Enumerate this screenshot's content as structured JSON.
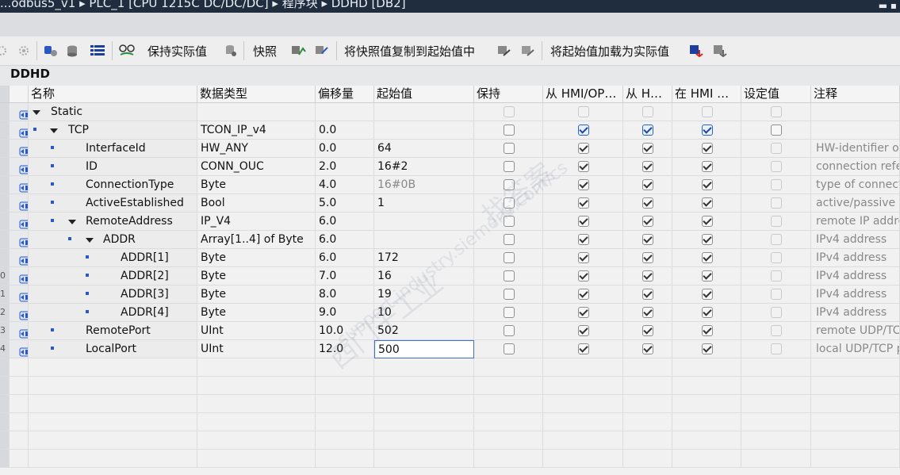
{
  "window": {
    "title": "...odbus5_v1 ▸ PLC_1 [CPU 1215C DC/DC/DC] ▸ 程序块 ▸ DDHD [DB2]"
  },
  "toolbar": {
    "keep_actual_label": "保持实际值",
    "snapshot_label": "快照",
    "copy_snapshot_label": "将快照值复制到起始值中",
    "load_start_label": "将起始值加载为实际值"
  },
  "block": {
    "name": "DDHD"
  },
  "columns": {
    "name": "名称",
    "datatype": "数据类型",
    "offset": "偏移量",
    "start": "起始值",
    "retain": "保持",
    "hmi_access": "从 HMI/OP…",
    "hmi_write": "从 H…",
    "hmi_visible": "在 HMI …",
    "setpoint": "设定值",
    "comment": "注释"
  },
  "rows": [
    {
      "num": "",
      "name": "Static",
      "type": "",
      "offset": "",
      "start": "",
      "comment": ""
    },
    {
      "num": "",
      "name": "TCP",
      "type": "TCON_IP_v4",
      "offset": "0.0",
      "start": "",
      "comment": ""
    },
    {
      "num": "",
      "name": "InterfaceId",
      "type": "HW_ANY",
      "offset": "0.0",
      "start": "64",
      "comment": "HW-identifier of I"
    },
    {
      "num": "",
      "name": "ID",
      "type": "CONN_OUC",
      "offset": "2.0",
      "start": "16#2",
      "comment": "connection refere"
    },
    {
      "num": "",
      "name": "ConnectionType",
      "type": "Byte",
      "offset": "4.0",
      "start": "16#0B",
      "comment": "type of connectio"
    },
    {
      "num": "",
      "name": "ActiveEstablished",
      "type": "Bool",
      "offset": "5.0",
      "start": "1",
      "comment": "active/passive co"
    },
    {
      "num": "",
      "name": "RemoteAddress",
      "type": "IP_V4",
      "offset": "6.0",
      "start": "",
      "comment": "remote IP addres"
    },
    {
      "num": "",
      "name": "ADDR",
      "type": "Array[1..4] of Byte",
      "offset": "6.0",
      "start": "",
      "comment": "IPv4 address"
    },
    {
      "num": "",
      "name": "ADDR[1]",
      "type": "Byte",
      "offset": "6.0",
      "start": "172",
      "comment": "IPv4 address"
    },
    {
      "num": "0",
      "name": "ADDR[2]",
      "type": "Byte",
      "offset": "7.0",
      "start": "16",
      "comment": "IPv4 address"
    },
    {
      "num": "1",
      "name": "ADDR[3]",
      "type": "Byte",
      "offset": "8.0",
      "start": "19",
      "comment": "IPv4 address"
    },
    {
      "num": "2",
      "name": "ADDR[4]",
      "type": "Byte",
      "offset": "9.0",
      "start": "10",
      "comment": "IPv4 address"
    },
    {
      "num": "3",
      "name": "RemotePort",
      "type": "UInt",
      "offset": "10.0",
      "start": "502",
      "comment": "remote UDP/TCP"
    },
    {
      "num": "4",
      "name": "LocalPort",
      "type": "UInt",
      "offset": "12.0",
      "start": "500",
      "comment": "local UDP/TCP po"
    }
  ],
  "watermark": {
    "line1": "西门子工业",
    "line2": "support.industry.siemens.com/cs",
    "line3": "找答案"
  },
  "colors": {
    "titlebar": "#1f2d3f",
    "accent": "#2b58c4",
    "edit_border": "#3a6fd0"
  }
}
